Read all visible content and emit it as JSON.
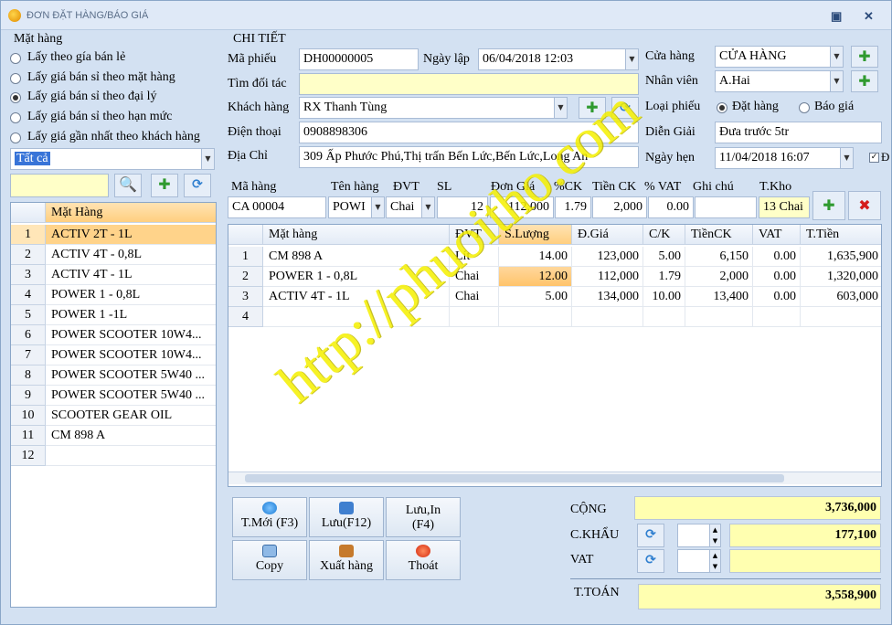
{
  "window": {
    "title": "ĐƠN ĐẶT HÀNG/BÁO GIÁ",
    "pin": "▣",
    "close": "✕"
  },
  "left": {
    "group_label": "Mặt hàng",
    "price_options": [
      {
        "label": "Lấy theo gía bán lẻ",
        "selected": false
      },
      {
        "label": "Lấy giá bán sỉ theo mặt hàng",
        "selected": false
      },
      {
        "label": "Lấy giá bán sỉ theo đại lý",
        "selected": true
      },
      {
        "label": "Lấy giá bán sỉ theo hạn mức",
        "selected": false
      },
      {
        "label": "Lấy giá gần nhất theo khách hàng",
        "selected": false
      }
    ],
    "filter_value": "Tất cả",
    "search_value": "",
    "grid_header": "Mặt Hàng",
    "items": [
      {
        "no": "1",
        "name": "ACTIV 2T - 1L"
      },
      {
        "no": "2",
        "name": "ACTIV 4T - 0,8L"
      },
      {
        "no": "3",
        "name": "ACTIV 4T - 1L"
      },
      {
        "no": "4",
        "name": "POWER 1 - 0,8L"
      },
      {
        "no": "5",
        "name": "POWER 1 -1L"
      },
      {
        "no": "6",
        "name": "POWER SCOOTER 10W4..."
      },
      {
        "no": "7",
        "name": "POWER SCOOTER 10W4..."
      },
      {
        "no": "8",
        "name": "POWER SCOOTER 5W40 ..."
      },
      {
        "no": "9",
        "name": "POWER SCOOTER 5W40 ..."
      },
      {
        "no": "10",
        "name": "SCOOTER GEAR OIL"
      },
      {
        "no": "11",
        "name": "CM 898 A"
      },
      {
        "no": "12",
        "name": ""
      }
    ]
  },
  "detail": {
    "section_title": "CHI TIẾT",
    "ma_phieu_label": "Mã phiếu",
    "ma_phieu": "DH00000005",
    "ngay_lap_label": "Ngày lập",
    "ngay_lap": "06/04/2018 12:03",
    "tim_doi_tac_label": "Tìm đối tác",
    "tim_doi_tac": "",
    "khach_hang_label": "Khách hàng",
    "khach_hang": "RX Thanh Tùng",
    "dien_thoai_label": "Điện thoại",
    "dien_thoai": "0908898306",
    "dia_chi_label": "Địa Chỉ",
    "dia_chi": "309 Ấp Phước Phú,Thị trấn Bến Lức,Bến Lức,Long An",
    "cua_hang_label": "Cửa hàng",
    "cua_hang": "CỬA HÀNG",
    "nhan_vien_label": "Nhân viên",
    "nhan_vien": "A.Hai",
    "loai_phieu_label": "Loại phiếu",
    "loai_dat_hang": "Đặt hàng",
    "loai_bao_gia": "Báo giá",
    "dien_giai_label": "Diễn Giải",
    "dien_giai": "Đưa trước 5tr",
    "ngay_hen_label": "Ngày hẹn",
    "ngay_hen": "11/04/2018 16:07",
    "check_label": "Đ"
  },
  "entry": {
    "h_ma_hang": "Mã hàng",
    "h_ten_hang": "Tên hàng",
    "h_dvt": "ĐVT",
    "h_sl": "SL",
    "h_don_gia": "Đơn Giá",
    "h_ck": "%CK",
    "h_tien_ck": "Tiền CK",
    "h_vat": "% VAT",
    "h_ghi_chu": "Ghi chú",
    "h_t_kho": "T.Kho",
    "ma_hang": "CA 00004",
    "ten_hang": "POWI",
    "dvt": "Chai",
    "sl": "12",
    "don_gia": "112,000",
    "ck": "1.79",
    "tien_ck": "2,000",
    "vat": "0.00",
    "ghi_chu": "",
    "t_kho": "13 Chai"
  },
  "lines": {
    "headers": [
      "Mặt hàng",
      "ĐVT",
      "S.Lượng",
      "Đ.Giá",
      "C/K",
      "TiềnCK",
      "VAT",
      "T.Tiền"
    ],
    "rows": [
      {
        "no": "1",
        "item": "CM 898 A",
        "dvt": "Lít",
        "qty": "14.00",
        "price": "123,000",
        "ck": "5.00",
        "tienck": "6,150",
        "vat": "0.00",
        "total": "1,635,900"
      },
      {
        "no": "2",
        "item": "POWER 1 - 0,8L",
        "dvt": "Chai",
        "qty": "12.00",
        "price": "112,000",
        "ck": "1.79",
        "tienck": "2,000",
        "vat": "0.00",
        "total": "1,320,000"
      },
      {
        "no": "3",
        "item": "ACTIV 4T - 1L",
        "dvt": "Chai",
        "qty": "5.00",
        "price": "134,000",
        "ck": "10.00",
        "tienck": "13,400",
        "vat": "0.00",
        "total": "603,000"
      },
      {
        "no": "4",
        "item": "",
        "dvt": "",
        "qty": "",
        "price": "",
        "ck": "",
        "tienck": "",
        "vat": "",
        "total": ""
      }
    ]
  },
  "buttons": {
    "new": "T.Mới (F3)",
    "save": "Lưu(F12)",
    "save_print_1": "Lưu,In",
    "save_print_2": "(F4)",
    "copy": "Copy",
    "export": "Xuất hàng",
    "exit": "Thoát"
  },
  "totals": {
    "cong_label": "CỘNG",
    "cong": "3,736,000",
    "ck_label": "C.KHẨU",
    "ck": "177,100",
    "vat_label": "VAT",
    "vat": "",
    "ttoan_label": "T.TOÁN",
    "ttoan": "3,558,900"
  },
  "watermark": "http://phuoitho.com",
  "colors": {
    "background": "#d3e1f2",
    "highlight": "#ffd38a",
    "yellow": "#ffffb0"
  }
}
